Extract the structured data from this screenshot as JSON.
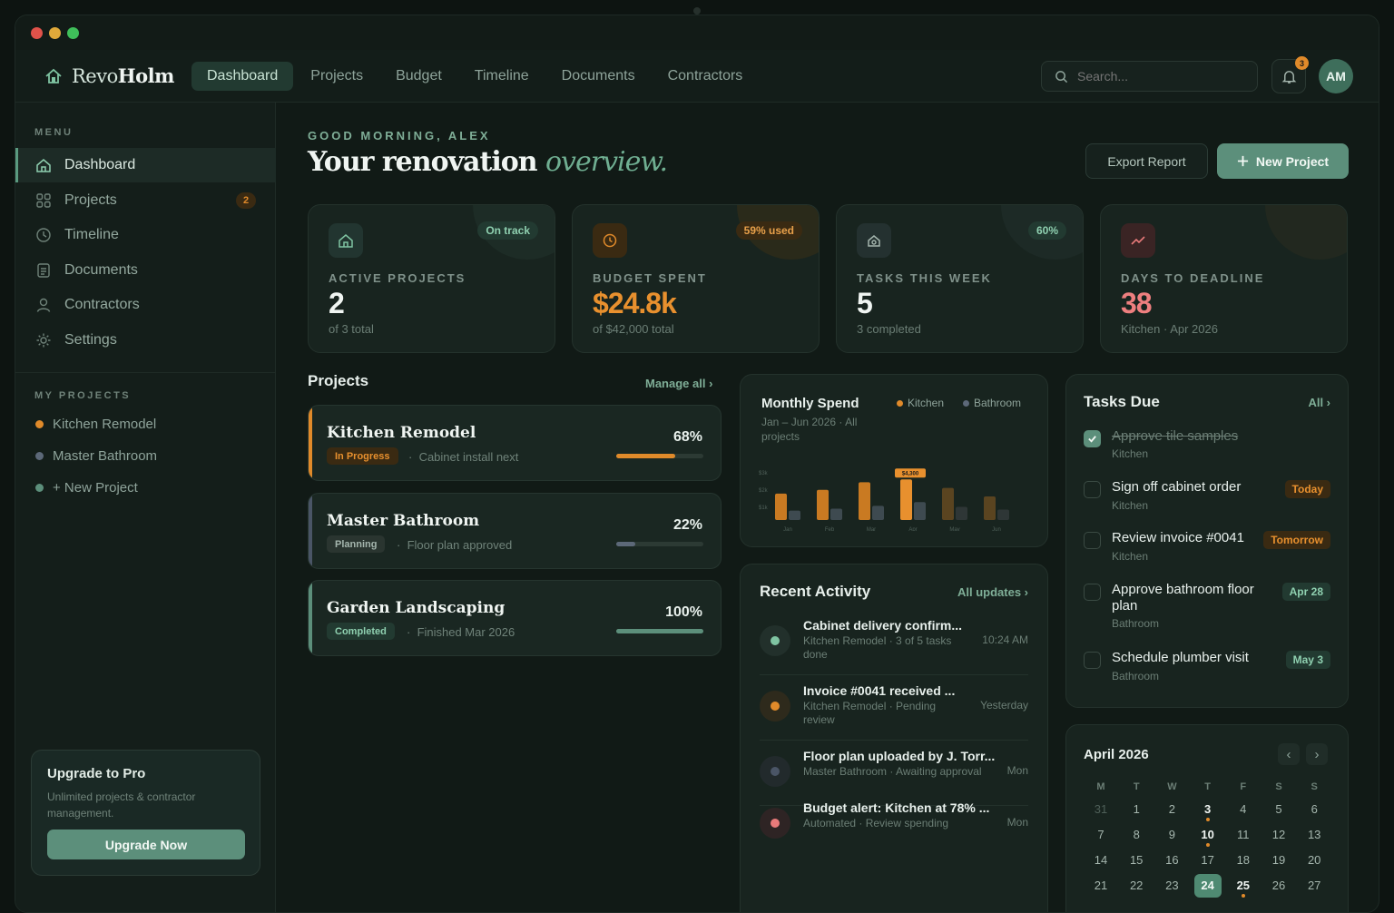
{
  "app": {
    "logo_light": "Revo",
    "logo_bold": "Holm"
  },
  "nav": {
    "tabs": [
      "Dashboard",
      "Projects",
      "Budget",
      "Timeline",
      "Documents",
      "Contractors"
    ],
    "active": 0
  },
  "search": {
    "placeholder": "Search..."
  },
  "notifications": {
    "count": "3"
  },
  "user": {
    "initials": "AM"
  },
  "sidebar": {
    "menu_title": "MENU",
    "items": [
      {
        "label": "Dashboard",
        "icon": "home-icon"
      },
      {
        "label": "Projects",
        "icon": "grid-icon",
        "badge": "2"
      },
      {
        "label": "Timeline",
        "icon": "clock-icon"
      },
      {
        "label": "Documents",
        "icon": "document-icon"
      },
      {
        "label": "Contractors",
        "icon": "user-icon"
      },
      {
        "label": "Settings",
        "icon": "settings-icon"
      }
    ],
    "projects_title": "MY PROJECTS",
    "projects": [
      {
        "label": "Kitchen Remodel",
        "color": "#e08a2a"
      },
      {
        "label": "Master Bathroom",
        "color": "#5c6878"
      },
      {
        "label": "+ New Project",
        "color": "#5c8f7b"
      }
    ],
    "upgrade": {
      "title": "Upgrade to Pro",
      "text": "Unlimited projects & contractor management.",
      "button": "Upgrade Now"
    }
  },
  "header": {
    "greeting": "GOOD MORNING, ALEX",
    "title_main": "Your renovation ",
    "title_em": "overview.",
    "export_label": "Export Report",
    "new_label": "New Project"
  },
  "stats": [
    {
      "pill": "On track",
      "label": "ACTIVE PROJECTS",
      "value": "2",
      "sub": "of 3 total",
      "icon": "home-icon",
      "accent": "#7fc4a2"
    },
    {
      "pill": "59% used",
      "label": "BUDGET SPENT",
      "value": "$24.8k",
      "sub": "of $42,000 total",
      "icon": "clock-icon",
      "accent": "#e08a2a"
    },
    {
      "pill": "60%",
      "label": "TASKS THIS WEEK",
      "value": "5",
      "sub": "3 completed",
      "icon": "house-icon",
      "accent": "#7fc4a2"
    },
    {
      "pill": "",
      "label": "DAYS TO DEADLINE",
      "value": "38",
      "sub": "Kitchen · Apr 2026",
      "icon": "trend-icon",
      "accent": "#e87a7a"
    }
  ],
  "projects": {
    "title": "Projects",
    "manage": "Manage all",
    "items": [
      {
        "name": "Kitchen Remodel",
        "status": "In Progress",
        "note": "Cabinet install next",
        "percent": "68%",
        "progress": 0.68,
        "color": "#e08a2a"
      },
      {
        "name": "Master Bathroom",
        "status": "Planning",
        "note": "Floor plan approved",
        "percent": "22%",
        "progress": 0.22,
        "color": "#5c6878"
      },
      {
        "name": "Garden Landscaping",
        "status": "Completed",
        "note": "Finished Mar 2026",
        "percent": "100%",
        "progress": 1.0,
        "color": "#5c8f7b"
      }
    ]
  },
  "spend": {
    "title": "Monthly Spend",
    "subtitle": "Jan – Jun 2026 · All projects"
  },
  "chart_data": {
    "type": "bar",
    "categories": [
      "Jan",
      "Feb",
      "Mar",
      "Apr",
      "May",
      "Jun"
    ],
    "series": [
      {
        "name": "Kitchen",
        "values": [
          2800,
          3200,
          4000,
          4300,
          3400,
          2500
        ]
      },
      {
        "name": "Bathroom",
        "values": [
          1000,
          1200,
          1500,
          1900,
          1400,
          1100
        ]
      }
    ],
    "y_ticks": [
      "$3k",
      "$2k",
      "$1k"
    ],
    "highlight_label": "$4,300",
    "highlight_index": 3,
    "ylim": [
      0,
      5000
    ]
  },
  "activity": {
    "title": "Recent Activity",
    "link": "All updates ›",
    "items": [
      {
        "title": "Cabinet delivery confirm...",
        "desc": "Kitchen Remodel · 3 of 5 tasks done",
        "time": "10:24 AM",
        "color": "#7fc4a2"
      },
      {
        "title": "Invoice #0041 received ...",
        "desc": "Kitchen Remodel · Pending review",
        "time": "Yesterday",
        "color": "#e08a2a"
      },
      {
        "title": "Floor plan uploaded by J. Torr...",
        "desc": "Master Bathroom · Awaiting approval",
        "time": "Mon",
        "color": "#5c6878"
      },
      {
        "title": "Budget alert: Kitchen at 78% ...",
        "desc": "Automated · Review spending",
        "time": "Mon",
        "color": "#e87a7a"
      }
    ]
  },
  "tasks": {
    "title": "Tasks Due",
    "link": "All ›",
    "items": [
      {
        "title": "Approve tile samples",
        "sub": "Kitchen",
        "due": "",
        "done": true
      },
      {
        "title": "Sign off cabinet order",
        "sub": "Kitchen",
        "due": "Today",
        "due_color": "#e08a2a"
      },
      {
        "title": "Review invoice #0041",
        "sub": "Kitchen",
        "due": "Tomorrow",
        "due_color": "#e08a2a"
      },
      {
        "title": "Approve bathroom floor plan",
        "sub": "Bathroom",
        "due": "Apr 28",
        "due_color": "#7fc4a2"
      },
      {
        "title": "Schedule plumber visit",
        "sub": "Bathroom",
        "due": "May 3",
        "due_color": "#7fc4a2"
      }
    ]
  },
  "calendar": {
    "title": "April 2026",
    "weekdays": [
      "M",
      "T",
      "W",
      "T",
      "F",
      "S",
      "S"
    ],
    "days": [
      "31",
      "1",
      "2",
      "3",
      "4",
      "5",
      "6",
      "7",
      "8",
      "9",
      "10",
      "11",
      "12",
      "13",
      "14",
      "15",
      "16",
      "17",
      "18",
      "19",
      "20",
      "21",
      "22",
      "23",
      "24",
      "25",
      "26",
      "27"
    ],
    "selected": "24",
    "events": [
      "3",
      "10",
      "25"
    ]
  }
}
